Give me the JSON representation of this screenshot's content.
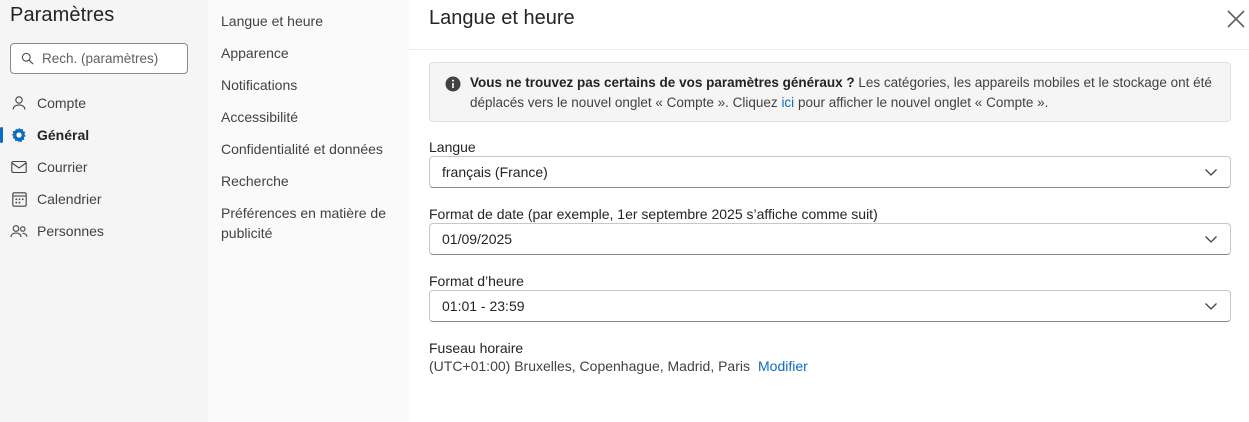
{
  "app": {
    "title": "Paramètres"
  },
  "search": {
    "placeholder": "Rech. (paramètres)"
  },
  "nav": {
    "items": [
      {
        "label": "Compte",
        "icon": "person-icon"
      },
      {
        "label": "Général",
        "icon": "gear-icon",
        "active": true
      },
      {
        "label": "Courrier",
        "icon": "mail-icon"
      },
      {
        "label": "Calendrier",
        "icon": "calendar-icon"
      },
      {
        "label": "Personnes",
        "icon": "people-icon"
      }
    ]
  },
  "subnav": {
    "items": [
      "Langue et heure",
      "Apparence",
      "Notifications",
      "Accessibilité",
      "Confidentialité et données",
      "Recherche",
      "Préférences en matière de publicité"
    ]
  },
  "main": {
    "title": "Langue et heure",
    "banner": {
      "bold": "Vous ne trouvez pas certains de vos paramètres généraux ?",
      "text1": " Les catégories, les appareils mobiles et le stockage ont été déplacés vers le nouvel onglet « Compte ». Cliquez ",
      "link": "ici",
      "text2": " pour afficher le nouvel onglet « Compte »."
    },
    "language": {
      "label": "Langue",
      "value": "français (France)"
    },
    "date_format": {
      "label": "Format de date (par exemple, 1er septembre 2025 s’affiche comme suit)",
      "value": "01/09/2025"
    },
    "time_format": {
      "label": "Format d’heure",
      "value": "01:01 - 23:59"
    },
    "timezone": {
      "label": "Fuseau horaire",
      "value": "(UTC+01:00) Bruxelles, Copenhague, Madrid, Paris",
      "action": "Modifier"
    }
  },
  "colors": {
    "accent": "#0f6cbd",
    "sidebar_bg": "#f5f5f5",
    "subnav_bg": "#fafafa"
  }
}
